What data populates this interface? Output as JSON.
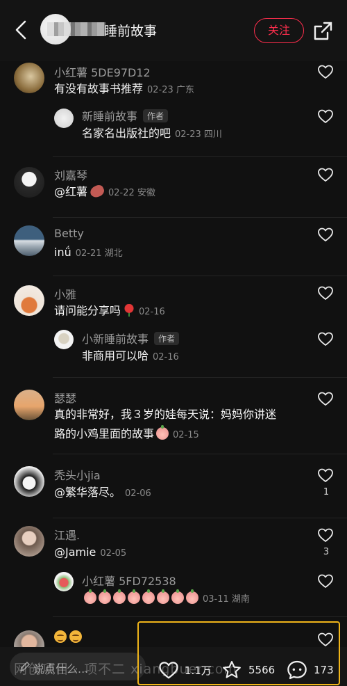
{
  "header": {
    "title": "睡前故事",
    "follow_label": "关注"
  },
  "comments": [
    {
      "user": "小红薯 5DE97D12",
      "text": "有没有故事书推荐",
      "meta": "02-23 广东"
    },
    {
      "user": "新睡前故事",
      "tag": "作者",
      "text": "名家名出版社的吧",
      "meta": "02-23 四川"
    },
    {
      "user": "刘嘉琴",
      "text": "@红薯",
      "meta": "02-22 安徽"
    },
    {
      "user": "Betty",
      "text": "inǘ",
      "meta": "02-21 湖北"
    },
    {
      "user": "小雅",
      "text": "请问能分享吗",
      "meta": "02-16"
    },
    {
      "user": "小新睡前故事",
      "tag": "作者",
      "text": "非商用可以哈",
      "meta": "02-16"
    },
    {
      "user": "瑟瑟",
      "text": "真的非常好，我３岁的娃每天说：妈妈你讲迷",
      "text2": "路的小鸡里面的故事",
      "meta": "02-15"
    },
    {
      "user": "秃头小jia",
      "text": "@繁华落尽。",
      "meta": "02-06",
      "likes": "1"
    },
    {
      "user": "江遇.",
      "text": "@Jamie",
      "meta": "02-05",
      "likes": "3"
    },
    {
      "user": "小红薯 5FD72538",
      "text": "",
      "meta": "03-11 湖南"
    }
  ],
  "bottom": {
    "input_placeholder": "说点什么...",
    "watermark": "网创项目 · 项不二  xiangbuer.com",
    "likes": "1.1万",
    "favorites": "5566",
    "comments": "173"
  },
  "colors": {
    "background": "#111111",
    "accent_red": "#ff2e4d",
    "highlight": "#f0b51a",
    "muted_text": "#9a9a9a"
  }
}
